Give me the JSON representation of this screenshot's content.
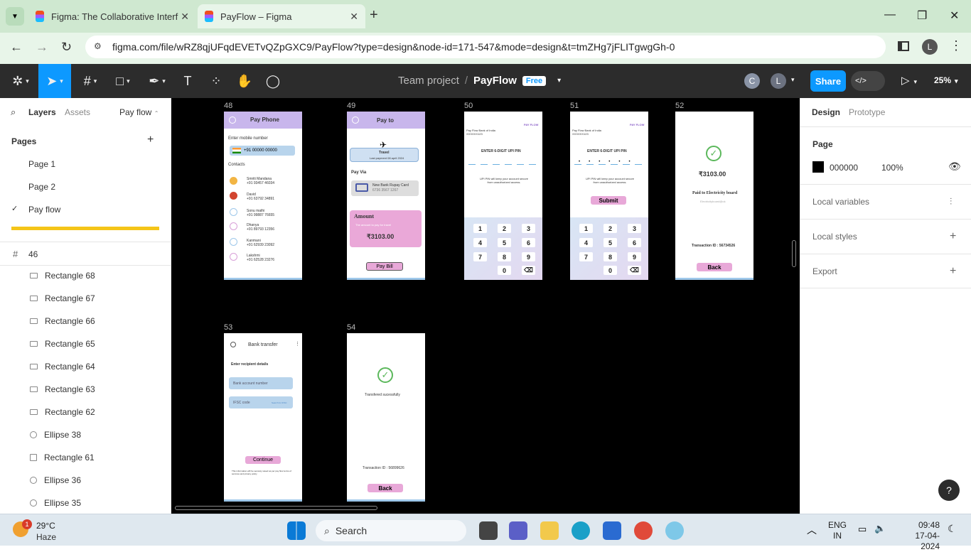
{
  "browser": {
    "tabs": [
      {
        "title": "Figma: The Collaborative Interf"
      },
      {
        "title": "PayFlow – Figma"
      }
    ],
    "url": "figma.com/file/wRZ8qjUFqdEVETvQZpGXC9/PayFlow?type=design&node-id=171-547&mode=design&t=tmZHg7jFLITgwgGh-0",
    "profile_initial": "L"
  },
  "figma": {
    "project": "Team project",
    "file": "PayFlow",
    "plan_badge": "Free",
    "avatars": [
      "C",
      "L"
    ],
    "share_label": "Share",
    "zoom": "25%"
  },
  "left_panel": {
    "tab_layers": "Layers",
    "tab_assets": "Assets",
    "page_select": "Pay flow",
    "pages_title": "Pages",
    "pages": [
      "Page 1",
      "Page 2",
      "Pay flow"
    ],
    "frame_name": "46",
    "layers": [
      "Rectangle 68",
      "Rectangle 67",
      "Rectangle 66",
      "Rectangle 65",
      "Rectangle 64",
      "Rectangle 63",
      "Rectangle 62",
      "Ellipse 38",
      "Rectangle 61",
      "Ellipse 36",
      "Ellipse 35"
    ]
  },
  "frames": {
    "labels": [
      "48",
      "49",
      "50",
      "51",
      "52",
      "53",
      "54"
    ],
    "f48": {
      "title": "Pay Phone",
      "enter": "Enter mobile number",
      "phone": "+91 00000 00000",
      "contacts_title": "Contacts",
      "contacts": [
        {
          "name": "Smriti Mandana",
          "num": "+91 93457 46034"
        },
        {
          "name": "David",
          "num": "+91 63792 34891"
        },
        {
          "name": "Sonu mathi",
          "num": "+91 99887 76655"
        },
        {
          "name": "Dhanya",
          "num": "+91 89793 12356"
        },
        {
          "name": "Kanmani",
          "num": "+91 62939 23092"
        },
        {
          "name": "Lakshmi",
          "num": "+91 62528 23276"
        }
      ]
    },
    "f49": {
      "title": "Pay to",
      "payee": "Travel",
      "last": "Last payment 08 april 2024",
      "pay_via": "Pay Via",
      "bank": "New Bank Rupay Card",
      "card": "6736 3567 1267",
      "amount_title": "Amount",
      "amount_hint": "The amount to pay for travel",
      "amount": "₹3103.00",
      "button": "Pay Bill"
    },
    "f50": {
      "bank": "Pay Flow Bank of India",
      "acct": "XXXXXX123",
      "brand": "PAY FLOW",
      "prompt": "ENTER 6-DIGIT UPI PIN",
      "note": "UPI PIN will keep your account secure from unauthorized access."
    },
    "f51": {
      "bank": "Pay Flow Bank of India",
      "acct": "XXXXXX123",
      "brand": "PAY FLOW",
      "prompt": "ENTER 6-DIGIT UPI PIN",
      "note": "UPI PIN will keep your account secure from unauthorized access.",
      "button": "Submit"
    },
    "f52": {
      "amount": "₹3103.00",
      "paid": "Paid to Electricity board",
      "sub": "Electricityboard@ok",
      "txn": "Transaction ID : 56734526",
      "button": "Back"
    },
    "f53": {
      "title": "Bank transfer",
      "heading": "Enter recipient details",
      "field1": "Bank account number",
      "field2": "IFSC code",
      "field2_hint": "Search for IFSC",
      "button": "Continue",
      "note": "This information will be securely saved as per pay flow terms of services and privacy policy"
    },
    "f54": {
      "status": "Transfered sucessfully",
      "txn": "Transaction ID : 56899626",
      "button": "Back"
    },
    "keys": [
      "1",
      "2",
      "3",
      "4",
      "5",
      "6",
      "7",
      "8",
      "9",
      "0",
      "⌫"
    ]
  },
  "right_panel": {
    "tab_design": "Design",
    "tab_prototype": "Prototype",
    "page_title": "Page",
    "bg_hex": "000000",
    "opacity": "100%",
    "local_variables": "Local variables",
    "local_styles": "Local styles",
    "export": "Export"
  },
  "taskbar": {
    "temp": "29°C",
    "weather": "Haze",
    "badge": "1",
    "search": "Search",
    "lang1": "ENG",
    "lang2": "IN",
    "time": "09:48",
    "date": "17-04-2024"
  },
  "colors": {
    "accent_blue": "#0d99ff",
    "frame_purple": "#c8b6ec",
    "pink": "#e8a8d8",
    "figma_bar": "#2c2c2c"
  }
}
